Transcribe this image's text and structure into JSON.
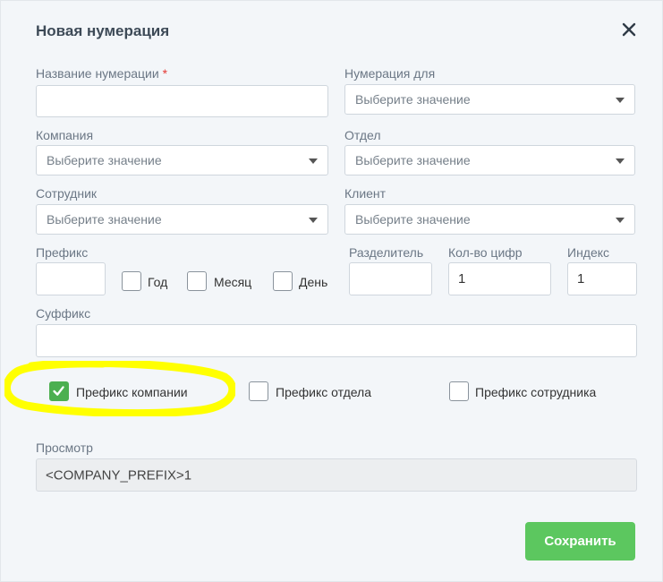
{
  "dialog": {
    "title": "Новая нумерация"
  },
  "form": {
    "name_label": "Название нумерации",
    "name_required_mark": "*",
    "name_value": "",
    "numbering_for_label": "Нумерация для",
    "numbering_for_value": "Выберите значение",
    "company_label": "Компания",
    "company_value": "Выберите значение",
    "department_label": "Отдел",
    "department_value": "Выберите значение",
    "employee_label": "Сотрудник",
    "employee_value": "Выберите значение",
    "client_label": "Клиент",
    "client_value": "Выберите значение",
    "prefix_label": "Префикс",
    "prefix_value": "",
    "year_label": "Год",
    "year_checked": false,
    "month_label": "Месяц",
    "month_checked": false,
    "day_label": "День",
    "day_checked": false,
    "separator_label": "Разделитель",
    "separator_value": "",
    "digits_label": "Кол-во цифр",
    "digits_value": "1",
    "index_label": "Индекс",
    "index_value": "1",
    "suffix_label": "Суффикс",
    "suffix_value": "",
    "company_prefix_label": "Префикс компании",
    "company_prefix_checked": true,
    "department_prefix_label": "Префикс отдела",
    "department_prefix_checked": false,
    "employee_prefix_label": "Префикс сотрудника",
    "employee_prefix_checked": false,
    "preview_label": "Просмотр",
    "preview_value": "<COMPANY_PREFIX>1"
  },
  "actions": {
    "save_label": "Сохранить"
  },
  "colors": {
    "accent_green": "#5cc75f",
    "highlight_yellow": "#ffff00",
    "required_red": "#e53935"
  },
  "icons": {
    "close": "close-icon",
    "check": "checkmark-icon",
    "dropdown": "chevron-down-icon"
  }
}
